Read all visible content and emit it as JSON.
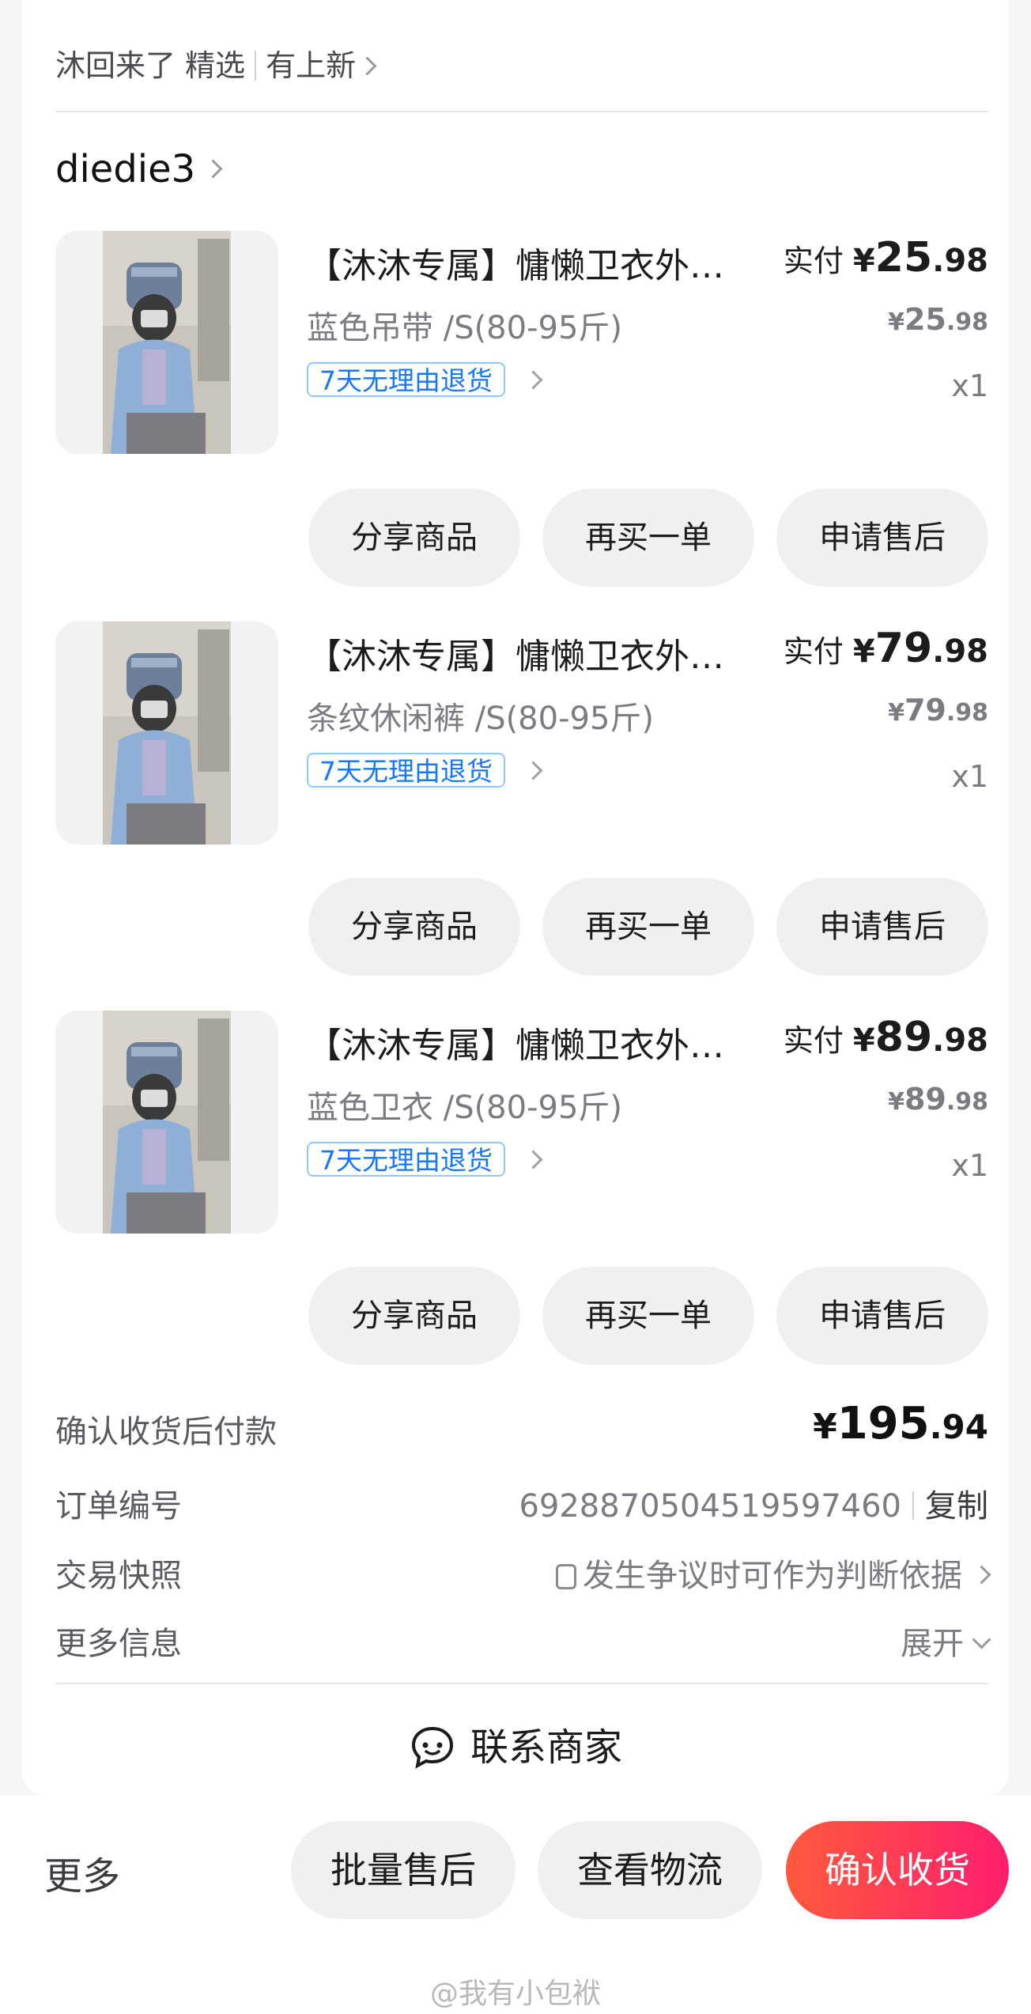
{
  "header": {
    "breadcrumb_1": "沐回来了 精选",
    "breadcrumb_2": "有上新"
  },
  "shop": {
    "name": "diedie3"
  },
  "items": [
    {
      "title": "【沐沐专属】慵懒卫衣外…",
      "spec": "蓝色吊带 /S(80-95斤)",
      "badge": "7天无理由退货",
      "paid_label": "实付",
      "paid_yen": "¥",
      "paid_int": "25",
      "paid_dec": ".98",
      "orig_yen": "¥",
      "orig_int": "25",
      "orig_dec": ".98",
      "qty": "x1",
      "actions": [
        "分享商品",
        "再买一单",
        "申请售后"
      ]
    },
    {
      "title": "【沐沐专属】慵懒卫衣外…",
      "spec": "条纹休闲裤 /S(80-95斤)",
      "badge": "7天无理由退货",
      "paid_label": "实付",
      "paid_yen": "¥",
      "paid_int": "79",
      "paid_dec": ".98",
      "orig_yen": "¥",
      "orig_int": "79",
      "orig_dec": ".98",
      "qty": "x1",
      "actions": [
        "分享商品",
        "再买一单",
        "申请售后"
      ]
    },
    {
      "title": "【沐沐专属】慵懒卫衣外…",
      "spec": "蓝色卫衣 /S(80-95斤)",
      "badge": "7天无理由退货",
      "paid_label": "实付",
      "paid_yen": "¥",
      "paid_int": "89",
      "paid_dec": ".98",
      "orig_yen": "¥",
      "orig_int": "89",
      "orig_dec": ".98",
      "qty": "x1",
      "actions": [
        "分享商品",
        "再买一单",
        "申请售后"
      ]
    }
  ],
  "summary": {
    "pay_label": "确认收货后付款",
    "total_yen": "¥",
    "total_int": "195",
    "total_dec": ".94",
    "order_label": "订单编号",
    "order_no": "6928870504519597460",
    "copy": "复制",
    "snapshot_label": "交易快照",
    "snapshot_value": "发生争议时可作为判断依据",
    "more_label": "更多信息",
    "expand": "展开"
  },
  "contact": {
    "label": "联系商家"
  },
  "bottom": {
    "more": "更多",
    "batch_after_sale": "批量售后",
    "view_logistics": "查看物流",
    "confirm_receipt": "确认收货"
  },
  "watermark": "@我有小包袱",
  "colors": {
    "badge_blue": "#1677ff",
    "confirm_start": "#ff5a3c",
    "confirm_end": "#ff1e6e"
  }
}
